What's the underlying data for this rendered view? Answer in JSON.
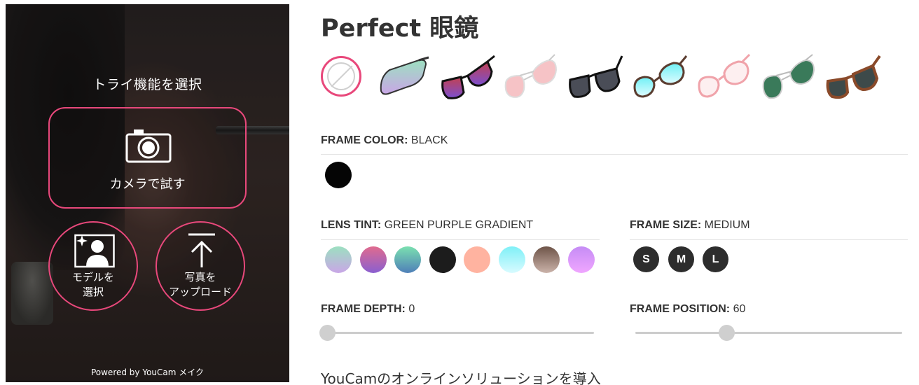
{
  "panel": {
    "title": "トライ機能を選択",
    "camera_label": "カメラで試す",
    "model_label_1": "モデルを",
    "model_label_2": "選択",
    "upload_label_1": "写真を",
    "upload_label_2": "アップロード",
    "powered": "Powered by YouCam メイク",
    "accent_color": "#e8487b"
  },
  "product": {
    "title": "Perfect 眼鏡",
    "glasses": [
      {
        "name": "none-option"
      },
      {
        "name": "sport-wrap-green-purple"
      },
      {
        "name": "black-red-gradient"
      },
      {
        "name": "pink-aviator"
      },
      {
        "name": "black-dark-lens"
      },
      {
        "name": "tortoise-cyan-mirror"
      },
      {
        "name": "pink-clear-frame"
      },
      {
        "name": "silver-green-aviator"
      },
      {
        "name": "tortoise-dark-lens"
      }
    ]
  },
  "frame_color": {
    "label": "FRAME COLOR:",
    "value": "BLACK",
    "swatches": [
      "#050505"
    ]
  },
  "lens_tint": {
    "label": "LENS TINT:",
    "value": "GREEN PURPLE GRADIENT",
    "swatches": [
      [
        "#9ce0c0",
        "#c9a6e6"
      ],
      [
        "#e06b8e",
        "#8a5fd0"
      ],
      [
        "#7be0b0",
        "#4f7fb8"
      ],
      [
        "#1c1c1c",
        "#1c1c1c"
      ],
      [
        "#ffb3a0",
        "#ffb3a0"
      ],
      [
        "#7ff0f7",
        "#d8fbff"
      ],
      [
        "#6e5448",
        "#cbb3aa"
      ],
      [
        "#c58cf5",
        "#f0a6ff"
      ]
    ]
  },
  "frame_size": {
    "label": "FRAME SIZE:",
    "value": "MEDIUM",
    "options": [
      "S",
      "M",
      "L"
    ]
  },
  "frame_depth": {
    "label": "FRAME DEPTH:",
    "value": "0",
    "fraction": 0.0
  },
  "frame_position": {
    "label": "FRAME POSITION:",
    "value": "60",
    "fraction": 0.34
  },
  "footer": {
    "text": "YouCamのオンラインソリューションを導入"
  }
}
